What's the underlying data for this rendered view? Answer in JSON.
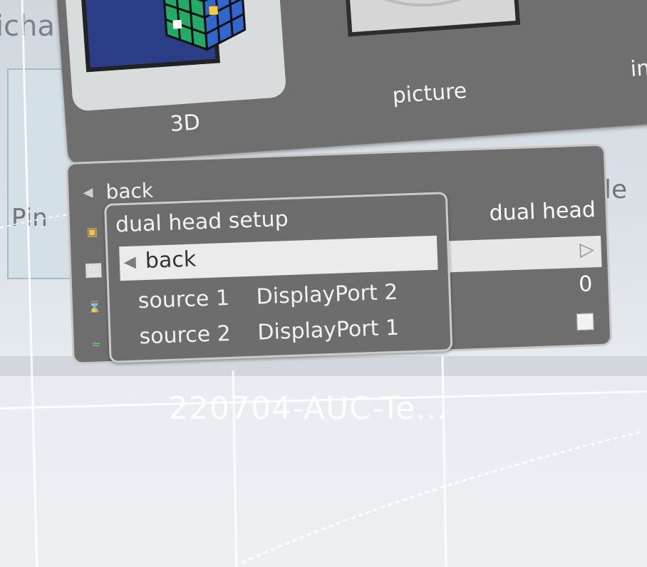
{
  "background": {
    "title_fragment": "icha",
    "left_panel_text": "Pin",
    "right_fragment": "le",
    "file_label": "220704-AUC-Te..."
  },
  "picker": {
    "items": [
      {
        "label": "3D",
        "icon": "rubiks-cube-icon"
      },
      {
        "label": "picture",
        "icon": "picture-frame-icon"
      },
      {
        "label": "in",
        "icon": "input-icon"
      }
    ]
  },
  "menu": {
    "back_label": "back",
    "selected_item_label": "dual head",
    "value": "0",
    "checkbox_checked": false
  },
  "submenu": {
    "title": "dual head setup",
    "back_label": "back",
    "rows": [
      {
        "label": "source 1",
        "value": "DisplayPort 2"
      },
      {
        "label": "source 2",
        "value": "DisplayPort 1"
      }
    ]
  },
  "colors": {
    "menu_bg": "#6e6e6e",
    "highlight_bg": "#e9e9e9",
    "menu_text": "#f2f2f2",
    "cube_blue": "#2a3d86"
  }
}
